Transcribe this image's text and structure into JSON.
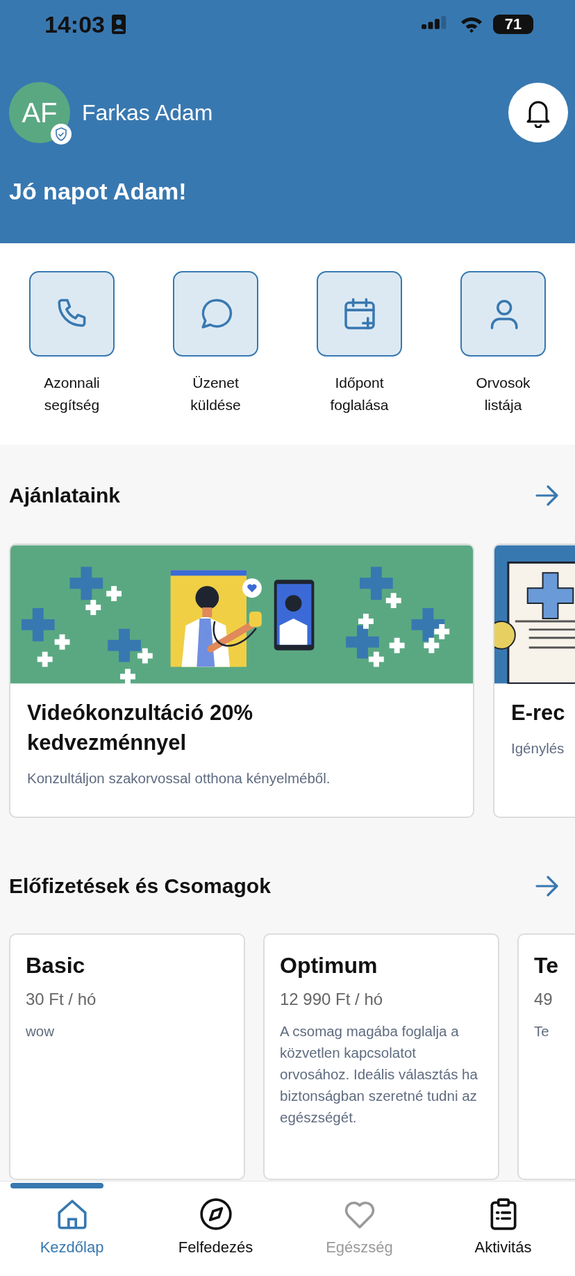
{
  "status_bar": {
    "time": "14:03",
    "battery": "71"
  },
  "profile": {
    "initials": "AF",
    "name": "Farkas Adam",
    "verified": true
  },
  "greeting": "Jó napot Adam!",
  "quick_actions": [
    {
      "kind": "phone",
      "label": "Azonnali segítség"
    },
    {
      "kind": "chat",
      "label": "Üzenet küldése"
    },
    {
      "kind": "calendar",
      "label": "Időpont foglalása"
    },
    {
      "kind": "person",
      "label": "Orvosok listája"
    }
  ],
  "offers": {
    "title": "Ajánlataink",
    "items": [
      {
        "kind": "video",
        "title": "Videókonzultáció 20% kedvezménnyel",
        "description": "Konzultáljon szakorvossal otthona kényelméből."
      },
      {
        "kind": "document",
        "title": "E-rec",
        "description": "Igénylés"
      }
    ]
  },
  "packages": {
    "title": "Előfizetések és Csomagok",
    "items": [
      {
        "title": "Basic",
        "price": "30 Ft / hó",
        "description": "wow"
      },
      {
        "title": "Optimum",
        "price": "12 990 Ft / hó",
        "description": "A csomag magába foglalja a közvetlen kapcsolatot orvosához. Ideális választás ha biztonságban szeretné tudni az egészségét."
      },
      {
        "title": "Te",
        "price": "49",
        "description": "Te"
      }
    ]
  },
  "nav": [
    {
      "kind": "home",
      "label": "Kezdőlap",
      "selected": true,
      "disabled": false
    },
    {
      "kind": "compass",
      "label": "Felfedezés",
      "selected": false,
      "disabled": false
    },
    {
      "kind": "heart",
      "label": "Egészség",
      "selected": false,
      "disabled": true
    },
    {
      "kind": "clipboard",
      "label": "Aktivitás",
      "selected": false,
      "disabled": false
    }
  ]
}
